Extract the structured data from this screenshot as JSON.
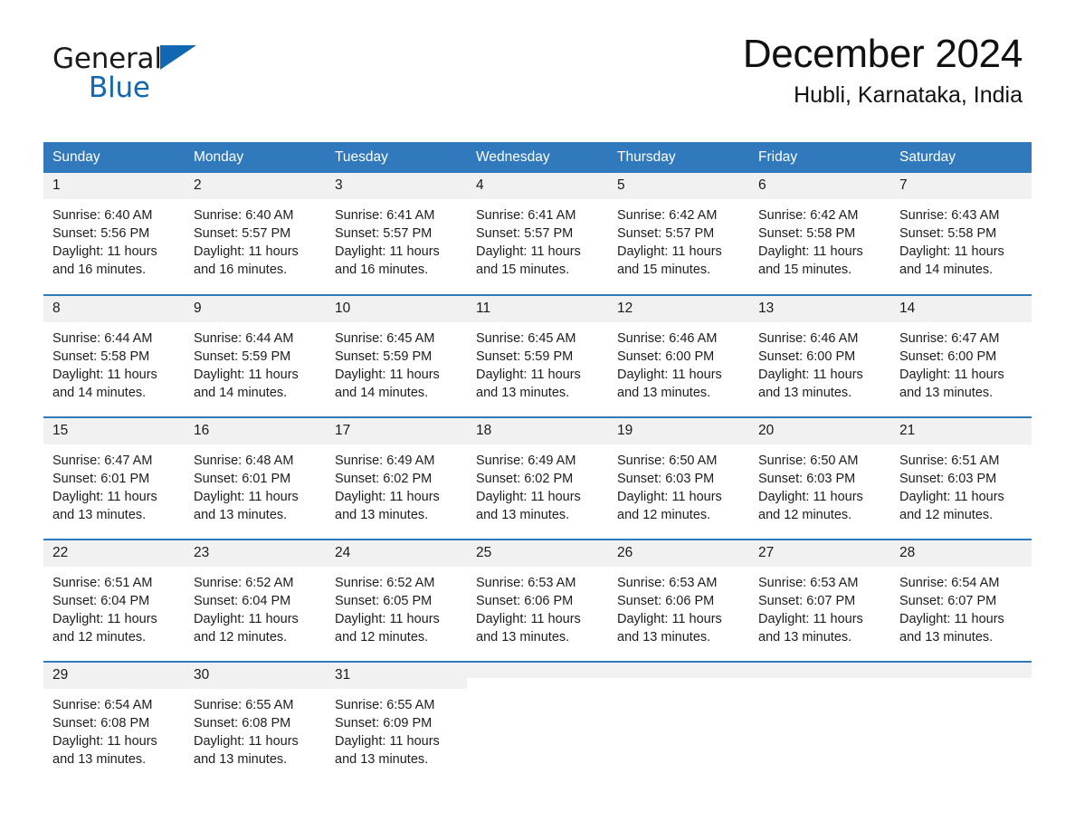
{
  "brand": {
    "name_part1": "General",
    "name_part2": "Blue",
    "accent_color": "#1167b1"
  },
  "header": {
    "month_title": "December 2024",
    "location": "Hubli, Karnataka, India"
  },
  "colors": {
    "header_blue": "#3079bd",
    "daynum_bg": "#f1f1f1",
    "text": "#1d1d1d"
  },
  "weekdays": [
    "Sunday",
    "Monday",
    "Tuesday",
    "Wednesday",
    "Thursday",
    "Friday",
    "Saturday"
  ],
  "weeks": [
    [
      {
        "day": "1",
        "sunrise": "Sunrise: 6:40 AM",
        "sunset": "Sunset: 5:56 PM",
        "daylight": "Daylight: 11 hours and 16 minutes."
      },
      {
        "day": "2",
        "sunrise": "Sunrise: 6:40 AM",
        "sunset": "Sunset: 5:57 PM",
        "daylight": "Daylight: 11 hours and 16 minutes."
      },
      {
        "day": "3",
        "sunrise": "Sunrise: 6:41 AM",
        "sunset": "Sunset: 5:57 PM",
        "daylight": "Daylight: 11 hours and 16 minutes."
      },
      {
        "day": "4",
        "sunrise": "Sunrise: 6:41 AM",
        "sunset": "Sunset: 5:57 PM",
        "daylight": "Daylight: 11 hours and 15 minutes."
      },
      {
        "day": "5",
        "sunrise": "Sunrise: 6:42 AM",
        "sunset": "Sunset: 5:57 PM",
        "daylight": "Daylight: 11 hours and 15 minutes."
      },
      {
        "day": "6",
        "sunrise": "Sunrise: 6:42 AM",
        "sunset": "Sunset: 5:58 PM",
        "daylight": "Daylight: 11 hours and 15 minutes."
      },
      {
        "day": "7",
        "sunrise": "Sunrise: 6:43 AM",
        "sunset": "Sunset: 5:58 PM",
        "daylight": "Daylight: 11 hours and 14 minutes."
      }
    ],
    [
      {
        "day": "8",
        "sunrise": "Sunrise: 6:44 AM",
        "sunset": "Sunset: 5:58 PM",
        "daylight": "Daylight: 11 hours and 14 minutes."
      },
      {
        "day": "9",
        "sunrise": "Sunrise: 6:44 AM",
        "sunset": "Sunset: 5:59 PM",
        "daylight": "Daylight: 11 hours and 14 minutes."
      },
      {
        "day": "10",
        "sunrise": "Sunrise: 6:45 AM",
        "sunset": "Sunset: 5:59 PM",
        "daylight": "Daylight: 11 hours and 14 minutes."
      },
      {
        "day": "11",
        "sunrise": "Sunrise: 6:45 AM",
        "sunset": "Sunset: 5:59 PM",
        "daylight": "Daylight: 11 hours and 13 minutes."
      },
      {
        "day": "12",
        "sunrise": "Sunrise: 6:46 AM",
        "sunset": "Sunset: 6:00 PM",
        "daylight": "Daylight: 11 hours and 13 minutes."
      },
      {
        "day": "13",
        "sunrise": "Sunrise: 6:46 AM",
        "sunset": "Sunset: 6:00 PM",
        "daylight": "Daylight: 11 hours and 13 minutes."
      },
      {
        "day": "14",
        "sunrise": "Sunrise: 6:47 AM",
        "sunset": "Sunset: 6:00 PM",
        "daylight": "Daylight: 11 hours and 13 minutes."
      }
    ],
    [
      {
        "day": "15",
        "sunrise": "Sunrise: 6:47 AM",
        "sunset": "Sunset: 6:01 PM",
        "daylight": "Daylight: 11 hours and 13 minutes."
      },
      {
        "day": "16",
        "sunrise": "Sunrise: 6:48 AM",
        "sunset": "Sunset: 6:01 PM",
        "daylight": "Daylight: 11 hours and 13 minutes."
      },
      {
        "day": "17",
        "sunrise": "Sunrise: 6:49 AM",
        "sunset": "Sunset: 6:02 PM",
        "daylight": "Daylight: 11 hours and 13 minutes."
      },
      {
        "day": "18",
        "sunrise": "Sunrise: 6:49 AM",
        "sunset": "Sunset: 6:02 PM",
        "daylight": "Daylight: 11 hours and 13 minutes."
      },
      {
        "day": "19",
        "sunrise": "Sunrise: 6:50 AM",
        "sunset": "Sunset: 6:03 PM",
        "daylight": "Daylight: 11 hours and 12 minutes."
      },
      {
        "day": "20",
        "sunrise": "Sunrise: 6:50 AM",
        "sunset": "Sunset: 6:03 PM",
        "daylight": "Daylight: 11 hours and 12 minutes."
      },
      {
        "day": "21",
        "sunrise": "Sunrise: 6:51 AM",
        "sunset": "Sunset: 6:03 PM",
        "daylight": "Daylight: 11 hours and 12 minutes."
      }
    ],
    [
      {
        "day": "22",
        "sunrise": "Sunrise: 6:51 AM",
        "sunset": "Sunset: 6:04 PM",
        "daylight": "Daylight: 11 hours and 12 minutes."
      },
      {
        "day": "23",
        "sunrise": "Sunrise: 6:52 AM",
        "sunset": "Sunset: 6:04 PM",
        "daylight": "Daylight: 11 hours and 12 minutes."
      },
      {
        "day": "24",
        "sunrise": "Sunrise: 6:52 AM",
        "sunset": "Sunset: 6:05 PM",
        "daylight": "Daylight: 11 hours and 12 minutes."
      },
      {
        "day": "25",
        "sunrise": "Sunrise: 6:53 AM",
        "sunset": "Sunset: 6:06 PM",
        "daylight": "Daylight: 11 hours and 13 minutes."
      },
      {
        "day": "26",
        "sunrise": "Sunrise: 6:53 AM",
        "sunset": "Sunset: 6:06 PM",
        "daylight": "Daylight: 11 hours and 13 minutes."
      },
      {
        "day": "27",
        "sunrise": "Sunrise: 6:53 AM",
        "sunset": "Sunset: 6:07 PM",
        "daylight": "Daylight: 11 hours and 13 minutes."
      },
      {
        "day": "28",
        "sunrise": "Sunrise: 6:54 AM",
        "sunset": "Sunset: 6:07 PM",
        "daylight": "Daylight: 11 hours and 13 minutes."
      }
    ],
    [
      {
        "day": "29",
        "sunrise": "Sunrise: 6:54 AM",
        "sunset": "Sunset: 6:08 PM",
        "daylight": "Daylight: 11 hours and 13 minutes."
      },
      {
        "day": "30",
        "sunrise": "Sunrise: 6:55 AM",
        "sunset": "Sunset: 6:08 PM",
        "daylight": "Daylight: 11 hours and 13 minutes."
      },
      {
        "day": "31",
        "sunrise": "Sunrise: 6:55 AM",
        "sunset": "Sunset: 6:09 PM",
        "daylight": "Daylight: 11 hours and 13 minutes."
      },
      {
        "day": "",
        "sunrise": "",
        "sunset": "",
        "daylight": ""
      },
      {
        "day": "",
        "sunrise": "",
        "sunset": "",
        "daylight": ""
      },
      {
        "day": "",
        "sunrise": "",
        "sunset": "",
        "daylight": ""
      },
      {
        "day": "",
        "sunrise": "",
        "sunset": "",
        "daylight": ""
      }
    ]
  ]
}
